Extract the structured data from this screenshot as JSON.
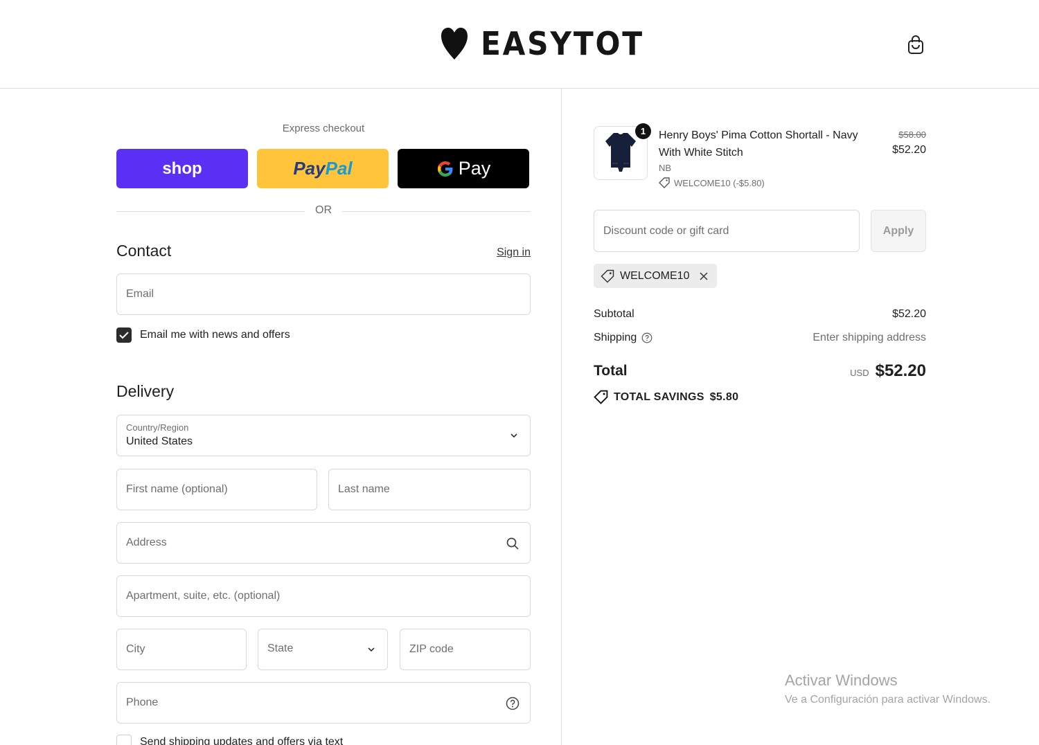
{
  "header": {
    "brand": "EASYTOT",
    "cart_icon": "shopping-bag-icon"
  },
  "express": {
    "title": "Express checkout",
    "shop_label": "shop",
    "paypal_part1": "Pay",
    "paypal_part2": "Pal",
    "gpay_label": "Pay",
    "or_label": "OR",
    "colors": {
      "shop": "#5a31f4",
      "paypal": "#ffc439",
      "gpay": "#000000"
    }
  },
  "contact": {
    "title": "Contact",
    "signin_label": "Sign in",
    "email_placeholder": "Email",
    "newsletter_label": "Email me with news and offers",
    "newsletter_checked": true
  },
  "delivery": {
    "title": "Delivery",
    "country_label": "Country/Region",
    "country_value": "United States",
    "first_name_placeholder": "First name (optional)",
    "last_name_placeholder": "Last name",
    "address_placeholder": "Address",
    "apartment_placeholder": "Apartment, suite, etc. (optional)",
    "city_placeholder": "City",
    "state_placeholder": "State",
    "zip_placeholder": "ZIP code",
    "phone_placeholder": "Phone",
    "sms_label": "Send shipping updates and offers via text",
    "sms_checked": false
  },
  "order": {
    "item": {
      "quantity": "1",
      "name": "Henry Boys' Pima Cotton Shortall - Navy With White Stitch",
      "variant": "NB",
      "discount": "WELCOME10 (-$5.80)",
      "original_price": "$58.00",
      "price": "$52.20"
    },
    "discount_placeholder": "Discount code or gift card",
    "apply_label": "Apply",
    "applied_code": "WELCOME10",
    "subtotal_label": "Subtotal",
    "subtotal_value": "$52.20",
    "shipping_label": "Shipping",
    "shipping_value": "Enter shipping address",
    "total_label": "Total",
    "currency": "USD",
    "total_value": "$52.20",
    "savings_label": "TOTAL SAVINGS",
    "savings_value": "$5.80"
  },
  "watermark": {
    "title": "Activar Windows",
    "subtitle": "Ve a Configuración para activar Windows."
  }
}
